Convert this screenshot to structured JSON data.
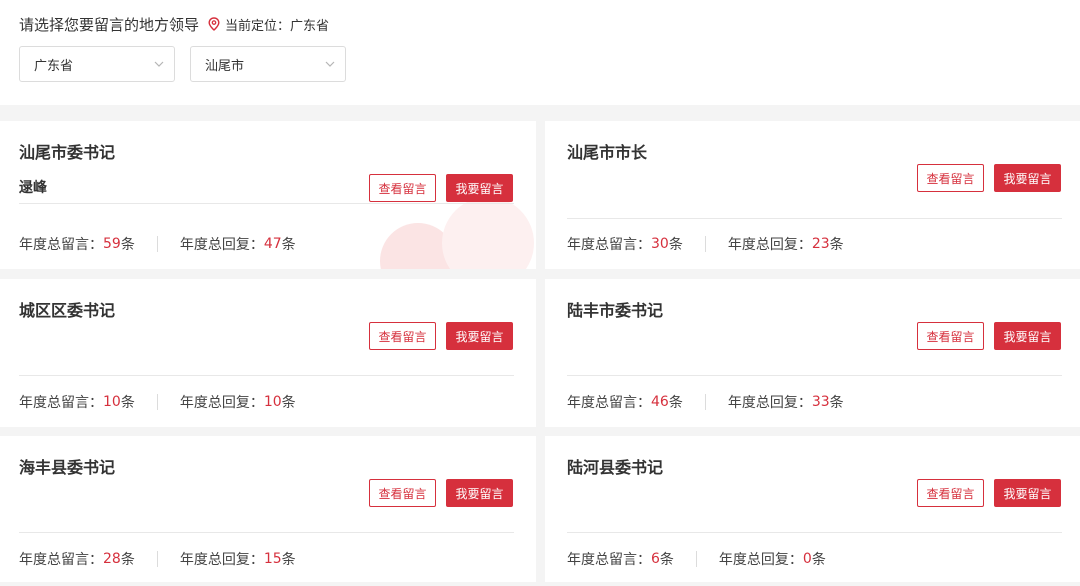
{
  "header": {
    "prompt": "请选择您要留言的地方领导",
    "location_label": "当前定位：广东省",
    "location_icon": "location-pin-icon",
    "province_select": "广东省",
    "city_select": "汕尾市"
  },
  "accent_color": "#d6303d",
  "cards": [
    {
      "title": "汕尾市委书记",
      "person": "逯峰",
      "view_label": "查看留言",
      "post_label": "我要留言",
      "messages_label": "年度总留言：",
      "messages_count": "59",
      "replies_label": "年度总回复：",
      "replies_count": "47",
      "unit": "条"
    },
    {
      "title": "汕尾市市长",
      "person": "",
      "view_label": "查看留言",
      "post_label": "我要留言",
      "messages_label": "年度总留言：",
      "messages_count": "30",
      "replies_label": "年度总回复：",
      "replies_count": "23",
      "unit": "条"
    },
    {
      "title": "城区区委书记",
      "person": "",
      "view_label": "查看留言",
      "post_label": "我要留言",
      "messages_label": "年度总留言：",
      "messages_count": "10",
      "replies_label": "年度总回复：",
      "replies_count": "10",
      "unit": "条"
    },
    {
      "title": "陆丰市委书记",
      "person": "",
      "view_label": "查看留言",
      "post_label": "我要留言",
      "messages_label": "年度总留言：",
      "messages_count": "46",
      "replies_label": "年度总回复：",
      "replies_count": "33",
      "unit": "条"
    },
    {
      "title": "海丰县委书记",
      "person": "",
      "view_label": "查看留言",
      "post_label": "我要留言",
      "messages_label": "年度总留言：",
      "messages_count": "28",
      "replies_label": "年度总回复：",
      "replies_count": "15",
      "unit": "条"
    },
    {
      "title": "陆河县委书记",
      "person": "",
      "view_label": "查看留言",
      "post_label": "我要留言",
      "messages_label": "年度总留言：",
      "messages_count": "6",
      "replies_label": "年度总回复：",
      "replies_count": "0",
      "unit": "条"
    }
  ]
}
